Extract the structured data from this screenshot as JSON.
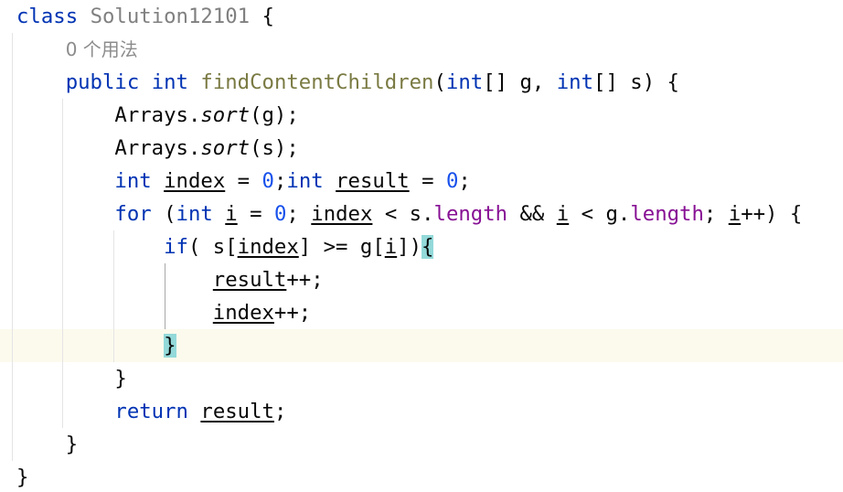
{
  "editor": {
    "lines": [
      {
        "indent": "",
        "tokens": [
          {
            "t": "class",
            "k": "kw"
          },
          {
            "t": " "
          },
          {
            "t": "Solution12101",
            "k": "cls"
          },
          {
            "t": " {"
          }
        ]
      },
      {
        "indent": "    ",
        "tokens": [
          {
            "t": "0 个用法",
            "k": "hint"
          }
        ]
      },
      {
        "indent": "    ",
        "tokens": [
          {
            "t": "public",
            "k": "kw"
          },
          {
            "t": " "
          },
          {
            "t": "int",
            "k": "kw"
          },
          {
            "t": " "
          },
          {
            "t": "findContentChildren",
            "k": "mth"
          },
          {
            "t": "("
          },
          {
            "t": "int",
            "k": "kw"
          },
          {
            "t": "[] g, "
          },
          {
            "t": "int",
            "k": "kw"
          },
          {
            "t": "[] s) {"
          }
        ]
      },
      {
        "indent": "        ",
        "tokens": [
          {
            "t": "Arrays."
          },
          {
            "t": "sort",
            "k": "it"
          },
          {
            "t": "(g);"
          }
        ]
      },
      {
        "indent": "        ",
        "tokens": [
          {
            "t": "Arrays."
          },
          {
            "t": "sort",
            "k": "it"
          },
          {
            "t": "(s);"
          }
        ]
      },
      {
        "indent": "        ",
        "tokens": [
          {
            "t": "int",
            "k": "kw"
          },
          {
            "t": " "
          },
          {
            "t": "index",
            "k": "ul"
          },
          {
            "t": " = "
          },
          {
            "t": "0",
            "k": "num"
          },
          {
            "t": ";"
          },
          {
            "t": "int",
            "k": "kw"
          },
          {
            "t": " "
          },
          {
            "t": "result",
            "k": "ul"
          },
          {
            "t": " = "
          },
          {
            "t": "0",
            "k": "num"
          },
          {
            "t": ";"
          }
        ]
      },
      {
        "indent": "        ",
        "tokens": [
          {
            "t": "for",
            "k": "kw"
          },
          {
            "t": " ("
          },
          {
            "t": "int",
            "k": "kw"
          },
          {
            "t": " "
          },
          {
            "t": "i",
            "k": "ul"
          },
          {
            "t": " = "
          },
          {
            "t": "0",
            "k": "num"
          },
          {
            "t": "; "
          },
          {
            "t": "index",
            "k": "ul"
          },
          {
            "t": " < s."
          },
          {
            "t": "length",
            "k": "fld"
          },
          {
            "t": " && "
          },
          {
            "t": "i",
            "k": "ul"
          },
          {
            "t": " < g."
          },
          {
            "t": "length",
            "k": "fld"
          },
          {
            "t": "; "
          },
          {
            "t": "i",
            "k": "ul"
          },
          {
            "t": "++) {"
          }
        ]
      },
      {
        "indent": "            ",
        "tokens": [
          {
            "t": "if",
            "k": "kw"
          },
          {
            "t": "( s["
          },
          {
            "t": "index",
            "k": "ul"
          },
          {
            "t": "] >= g["
          },
          {
            "t": "i",
            "k": "ul"
          },
          {
            "t": "])"
          },
          {
            "t": "{",
            "k": "brace"
          }
        ]
      },
      {
        "indent": "                ",
        "tokens": [
          {
            "t": "result",
            "k": "ul"
          },
          {
            "t": "++;"
          }
        ]
      },
      {
        "indent": "                ",
        "tokens": [
          {
            "t": "index",
            "k": "ul"
          },
          {
            "t": "++;"
          }
        ]
      },
      {
        "indent": "            ",
        "tokens": [
          {
            "t": "}",
            "k": "brace"
          }
        ]
      },
      {
        "indent": "        ",
        "tokens": [
          {
            "t": "}"
          }
        ]
      },
      {
        "indent": "        ",
        "tokens": [
          {
            "t": "return",
            "k": "kw"
          },
          {
            "t": " "
          },
          {
            "t": "result",
            "k": "ul"
          },
          {
            "t": ";"
          }
        ]
      },
      {
        "indent": "    ",
        "tokens": [
          {
            "t": "}"
          }
        ]
      },
      {
        "indent": "",
        "tokens": [
          {
            "t": "}"
          }
        ]
      }
    ]
  },
  "colors": {
    "keyword": "#0033b3",
    "number": "#1750eb",
    "field": "#871094",
    "class_name": "#808080",
    "method_name": "#7a7a43",
    "hint": "#8c8c8c",
    "brace_match_bg": "#93d9d9",
    "caret_line_bg": "#fcfaed"
  }
}
